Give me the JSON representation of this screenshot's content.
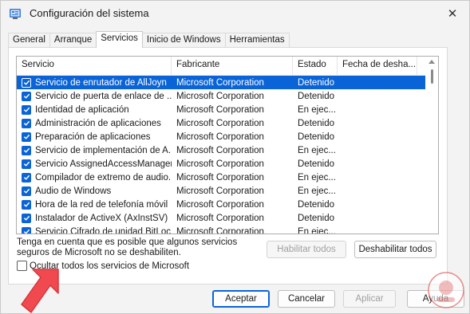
{
  "window": {
    "title": "Configuración del sistema",
    "close_glyph": "✕"
  },
  "tabs": [
    {
      "label": "General"
    },
    {
      "label": "Arranque"
    },
    {
      "label": "Servicios"
    },
    {
      "label": "Inicio de Windows"
    },
    {
      "label": "Herramientas"
    }
  ],
  "table": {
    "headers": [
      "Servicio",
      "Fabricante",
      "Estado",
      "Fecha de desha..."
    ],
    "rows": [
      {
        "service": "Servicio de enrutador de AllJoyn",
        "maker": "Microsoft Corporation",
        "status": "Detenido",
        "date": "",
        "checked": true,
        "selected": true
      },
      {
        "service": "Servicio de puerta de enlace de ...",
        "maker": "Microsoft Corporation",
        "status": "Detenido",
        "date": "",
        "checked": true,
        "selected": false
      },
      {
        "service": "Identidad de aplicación",
        "maker": "Microsoft Corporation",
        "status": "En ejec...",
        "date": "",
        "checked": true,
        "selected": false
      },
      {
        "service": "Administración de aplicaciones",
        "maker": "Microsoft Corporation",
        "status": "Detenido",
        "date": "",
        "checked": true,
        "selected": false
      },
      {
        "service": "Preparación de aplicaciones",
        "maker": "Microsoft Corporation",
        "status": "Detenido",
        "date": "",
        "checked": true,
        "selected": false
      },
      {
        "service": "Servicio de implementación de A...",
        "maker": "Microsoft Corporation",
        "status": "En ejec...",
        "date": "",
        "checked": true,
        "selected": false
      },
      {
        "service": "Servicio AssignedAccessManager",
        "maker": "Microsoft Corporation",
        "status": "Detenido",
        "date": "",
        "checked": true,
        "selected": false
      },
      {
        "service": "Compilador de extremo de audio...",
        "maker": "Microsoft Corporation",
        "status": "En ejec...",
        "date": "",
        "checked": true,
        "selected": false
      },
      {
        "service": "Audio de Windows",
        "maker": "Microsoft Corporation",
        "status": "En ejec...",
        "date": "",
        "checked": true,
        "selected": false
      },
      {
        "service": "Hora de la red de telefonía móvil",
        "maker": "Microsoft Corporation",
        "status": "Detenido",
        "date": "",
        "checked": true,
        "selected": false
      },
      {
        "service": "Instalador de ActiveX (AxInstSV)",
        "maker": "Microsoft Corporation",
        "status": "Detenido",
        "date": "",
        "checked": true,
        "selected": false
      },
      {
        "service": "Servicio Cifrado de unidad BitLoc...",
        "maker": "Microsoft Corporation",
        "status": "En ejec...",
        "date": "",
        "checked": true,
        "selected": false
      }
    ]
  },
  "note": {
    "line1": "Tenga en cuenta que es posible que algunos servicios",
    "line2": "seguros de Microsoft no se deshabiliten."
  },
  "buttons": {
    "enable_all": "Habilitar todos",
    "disable_all": "Deshabilitar todos",
    "ok": "Aceptar",
    "cancel": "Cancelar",
    "apply": "Aplicar",
    "help": "Ayuda"
  },
  "hide_ms": {
    "label": "Ocultar todos los servicios de Microsoft",
    "checked": false
  },
  "colors": {
    "accent": "#0a64d8",
    "arrow": "#f04a50"
  }
}
